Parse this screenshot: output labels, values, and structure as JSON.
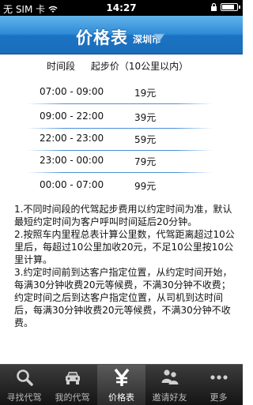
{
  "status_bar": {
    "carrier": "无 SIM 卡",
    "time": "14:27",
    "battery_level": 0.85
  },
  "header": {
    "title": "价格表",
    "city": "深圳市"
  },
  "price_table": {
    "headers": [
      "时间段",
      "起步价（10公里以内）"
    ],
    "rows": [
      {
        "time": "07:00 - 09:00",
        "price": "19元"
      },
      {
        "time": "09:00 - 22:00",
        "price": "39元"
      },
      {
        "time": "22:00 - 23:00",
        "price": "59元"
      },
      {
        "time": "23:00 - 00:00",
        "price": "79元"
      },
      {
        "time": "00:00 - 07:00",
        "price": "99元"
      }
    ]
  },
  "notes": [
    "1.不同时间段的代驾起步费用以约定时间为准，默认最短约定时间为客户呼叫时间延后20分钟。",
    "2.按照车内里程总表计算公里数，代驾距离超过10公里后，每超过10公里加收20元，不足10公里按10公里计算。",
    "3.约定时间前到达客户指定位置，从约定时间开始，每满30分钟收费20元等候费，不满30分钟不收费；约定时间之后到达客户指定位置，从司机到达时间后，每满30分钟收费20元等候费，不满30分钟不收费。"
  ],
  "tab_bar": {
    "tabs": [
      {
        "label": "寻找代驾",
        "icon": "search-icon"
      },
      {
        "label": "我的代驾",
        "icon": "car-icon"
      },
      {
        "label": "价格表",
        "icon": "yen-icon"
      },
      {
        "label": "邀请好友",
        "icon": "people-icon"
      },
      {
        "label": "更多",
        "icon": "more-icon"
      }
    ],
    "active_index": 2
  },
  "colors": {
    "header_blue": "#2d8ad6",
    "tab_bar_dark": "#1f1f1f",
    "divider_blue": "#4a90d9"
  }
}
